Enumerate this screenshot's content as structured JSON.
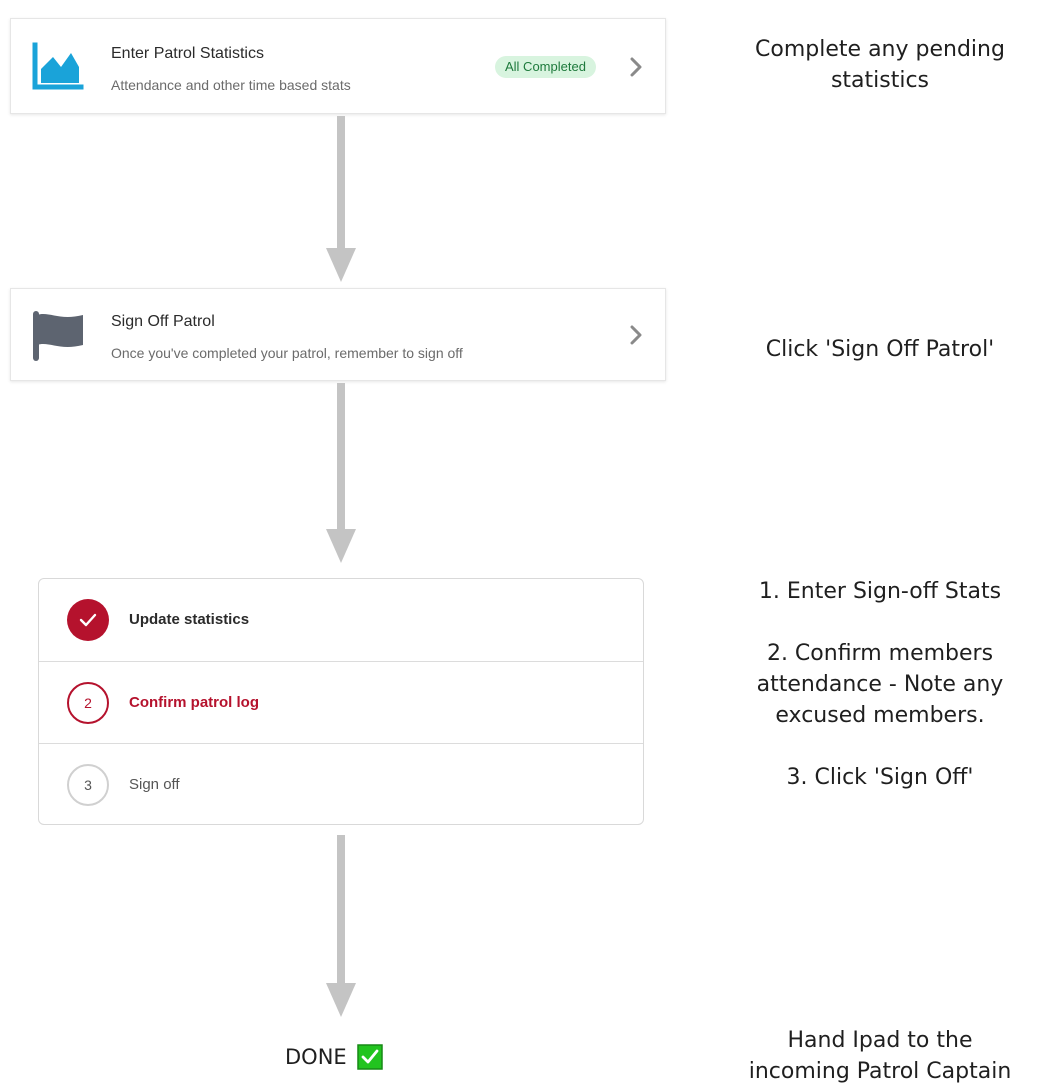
{
  "steps_cards": [
    {
      "title": "Enter Patrol Statistics",
      "subtitle": "Attendance and other time based stats",
      "badge": "All Completed",
      "icon": "chart-icon",
      "icon_color": "#1aa3d9"
    },
    {
      "title": "Sign Off Patrol",
      "subtitle": "Once you've completed your patrol, remember to sign off",
      "icon": "flag-icon",
      "icon_color": "#5d6470"
    }
  ],
  "stepper": {
    "steps": [
      {
        "number": "",
        "label": "Update statistics",
        "state": "completed"
      },
      {
        "number": "2",
        "label": "Confirm patrol log",
        "state": "active"
      },
      {
        "number": "3",
        "label": "Sign off",
        "state": "pending"
      }
    ],
    "accent": "#b5122d"
  },
  "notes": {
    "note1": [
      "Complete any pending",
      "statistics"
    ],
    "note2": [
      "Click 'Sign Off Patrol'"
    ],
    "note3": {
      "a": "1. Enter Sign-off Stats",
      "b": [
        "2. Confirm members",
        "attendance - Note any",
        "excused members."
      ],
      "c": "3. Click 'Sign Off'"
    },
    "note4": [
      "Hand Ipad to the",
      "incoming Patrol Captain"
    ]
  },
  "done": {
    "label": "DONE",
    "icon": "check-box-icon",
    "color": "#22c41f"
  },
  "arrow_color": "#c4c4c4"
}
